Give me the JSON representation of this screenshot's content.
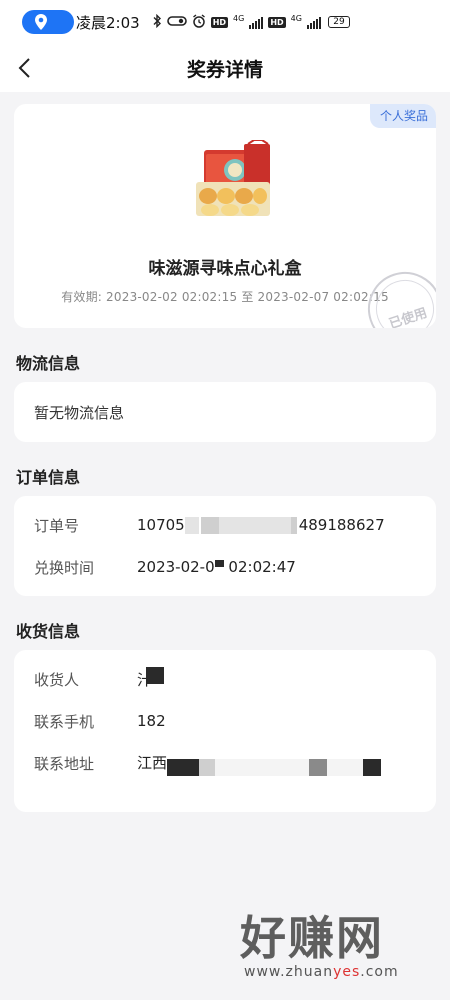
{
  "status_bar": {
    "time": "凌晨2:03",
    "network_1": "4G",
    "network_2": "4G",
    "hd_1": "HD",
    "hd_2": "HD",
    "battery": "29",
    "icons": [
      "location-icon",
      "bluetooth-icon",
      "link-icon",
      "alarm-icon",
      "signal-icon",
      "battery-icon"
    ]
  },
  "header": {
    "title": "奖券详情"
  },
  "prize": {
    "badge": "个人奖品",
    "name": "味滋源寻味点心礼盒",
    "validity": "有效期: 2023-02-02 02:02:15 至 2023-02-07 02:02:15",
    "stamp": "已使用"
  },
  "logistics": {
    "title": "物流信息",
    "empty_text": "暂无物流信息"
  },
  "order": {
    "title": "订单信息",
    "rows": [
      {
        "label": "订单号",
        "value_start": "10705",
        "value_end": "489188627"
      },
      {
        "label": "兑换时间",
        "value_start": "2023-02-0",
        "value_end": "02:02:47"
      }
    ]
  },
  "receiver": {
    "title": "收货信息",
    "rows": [
      {
        "label": "收货人",
        "value": "汁"
      },
      {
        "label": "联系手机",
        "value": "182"
      },
      {
        "label": "联系地址",
        "value": "江西"
      }
    ]
  },
  "watermark": {
    "brand": "好赚网",
    "url_1": "www.zhuan",
    "url_2": "yes",
    "url_3": ".com"
  },
  "colors": {
    "accent": "#1e74f5",
    "badge_bg": "#dde8fb",
    "badge_text": "#3a6fd8",
    "page_bg": "#f4f4f6"
  }
}
